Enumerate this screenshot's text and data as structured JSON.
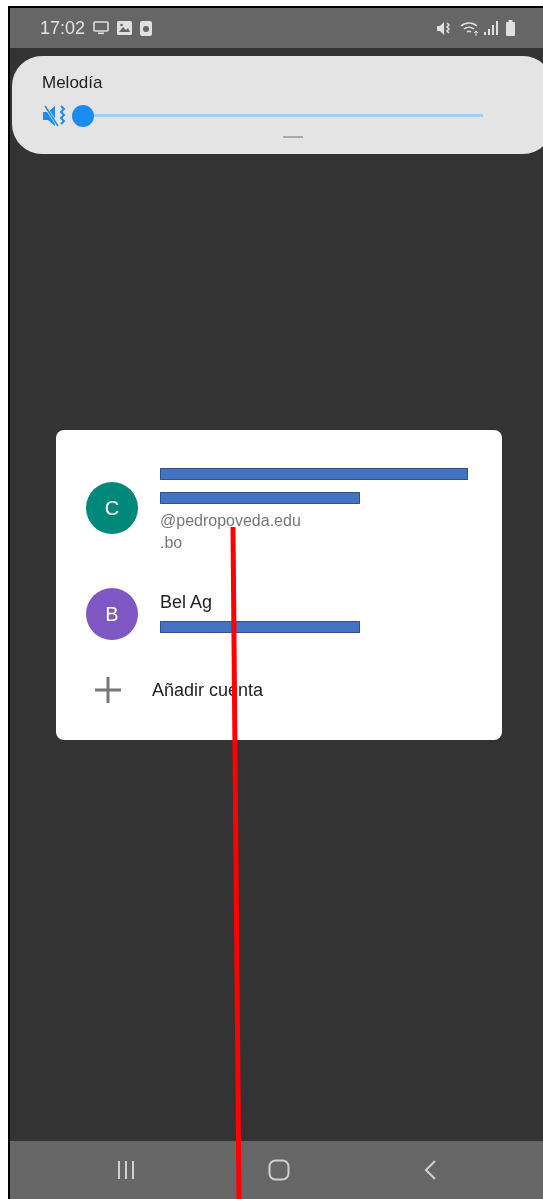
{
  "status_bar": {
    "time": "17:02"
  },
  "volume_panel": {
    "title": "Melodía",
    "muted": true,
    "level": 0
  },
  "account_picker": {
    "accounts": [
      {
        "initial": "C",
        "color": "#00897b",
        "lines": [
          {
            "kind": "redacted-name"
          },
          {
            "kind": "redacted-email"
          },
          {
            "kind": "email",
            "text": "@pedropoveda.edu"
          },
          {
            "kind": "email",
            "text": ".bo"
          }
        ]
      },
      {
        "initial": "B",
        "color": "#7e57c2",
        "lines": [
          {
            "kind": "name",
            "text": "Bel Ag"
          },
          {
            "kind": "redacted-email"
          }
        ]
      }
    ],
    "add_account": "Añadir cuenta"
  }
}
